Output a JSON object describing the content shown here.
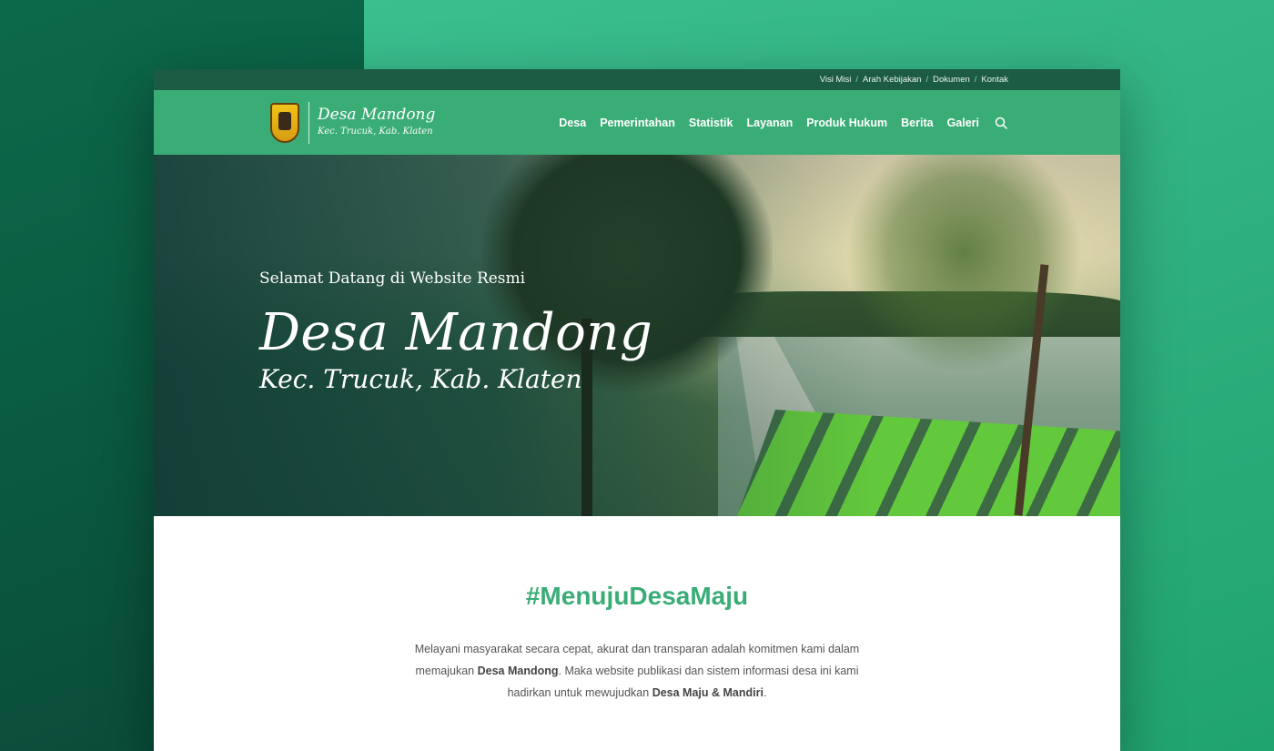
{
  "topbar": {
    "links": [
      "Visi Misi",
      "Arah Kebijakan",
      "Dokumen",
      "Kontak"
    ],
    "separator": "/"
  },
  "header": {
    "logo_title": "Desa Mandong",
    "logo_subtitle": "Kec. Trucuk, Kab. Klaten",
    "menu": [
      "Desa",
      "Pemerintahan",
      "Statistik",
      "Layanan",
      "Produk Hukum",
      "Berita",
      "Galeri"
    ],
    "search_icon": "search-icon"
  },
  "hero": {
    "greeting": "Selamat Datang di Website Resmi",
    "title": "Desa Mandong",
    "subtitle": "Kec. Trucuk, Kab. Klaten"
  },
  "main": {
    "tagline": "#MenujuDesaMaju",
    "intro_part1": "Melayani masyarakat secara cepat, akurat dan transparan adalah komitmen kami dalam memajukan ",
    "intro_bold1": "Desa Mandong",
    "intro_part2": ". Maka website publikasi dan sistem informasi desa ini kami hadirkan untuk mewujudkan ",
    "intro_bold2": "Desa Maju & Mandiri",
    "intro_part3": "."
  },
  "colors": {
    "primary_green": "#3aad76",
    "topbar_green": "#1c5c45"
  }
}
